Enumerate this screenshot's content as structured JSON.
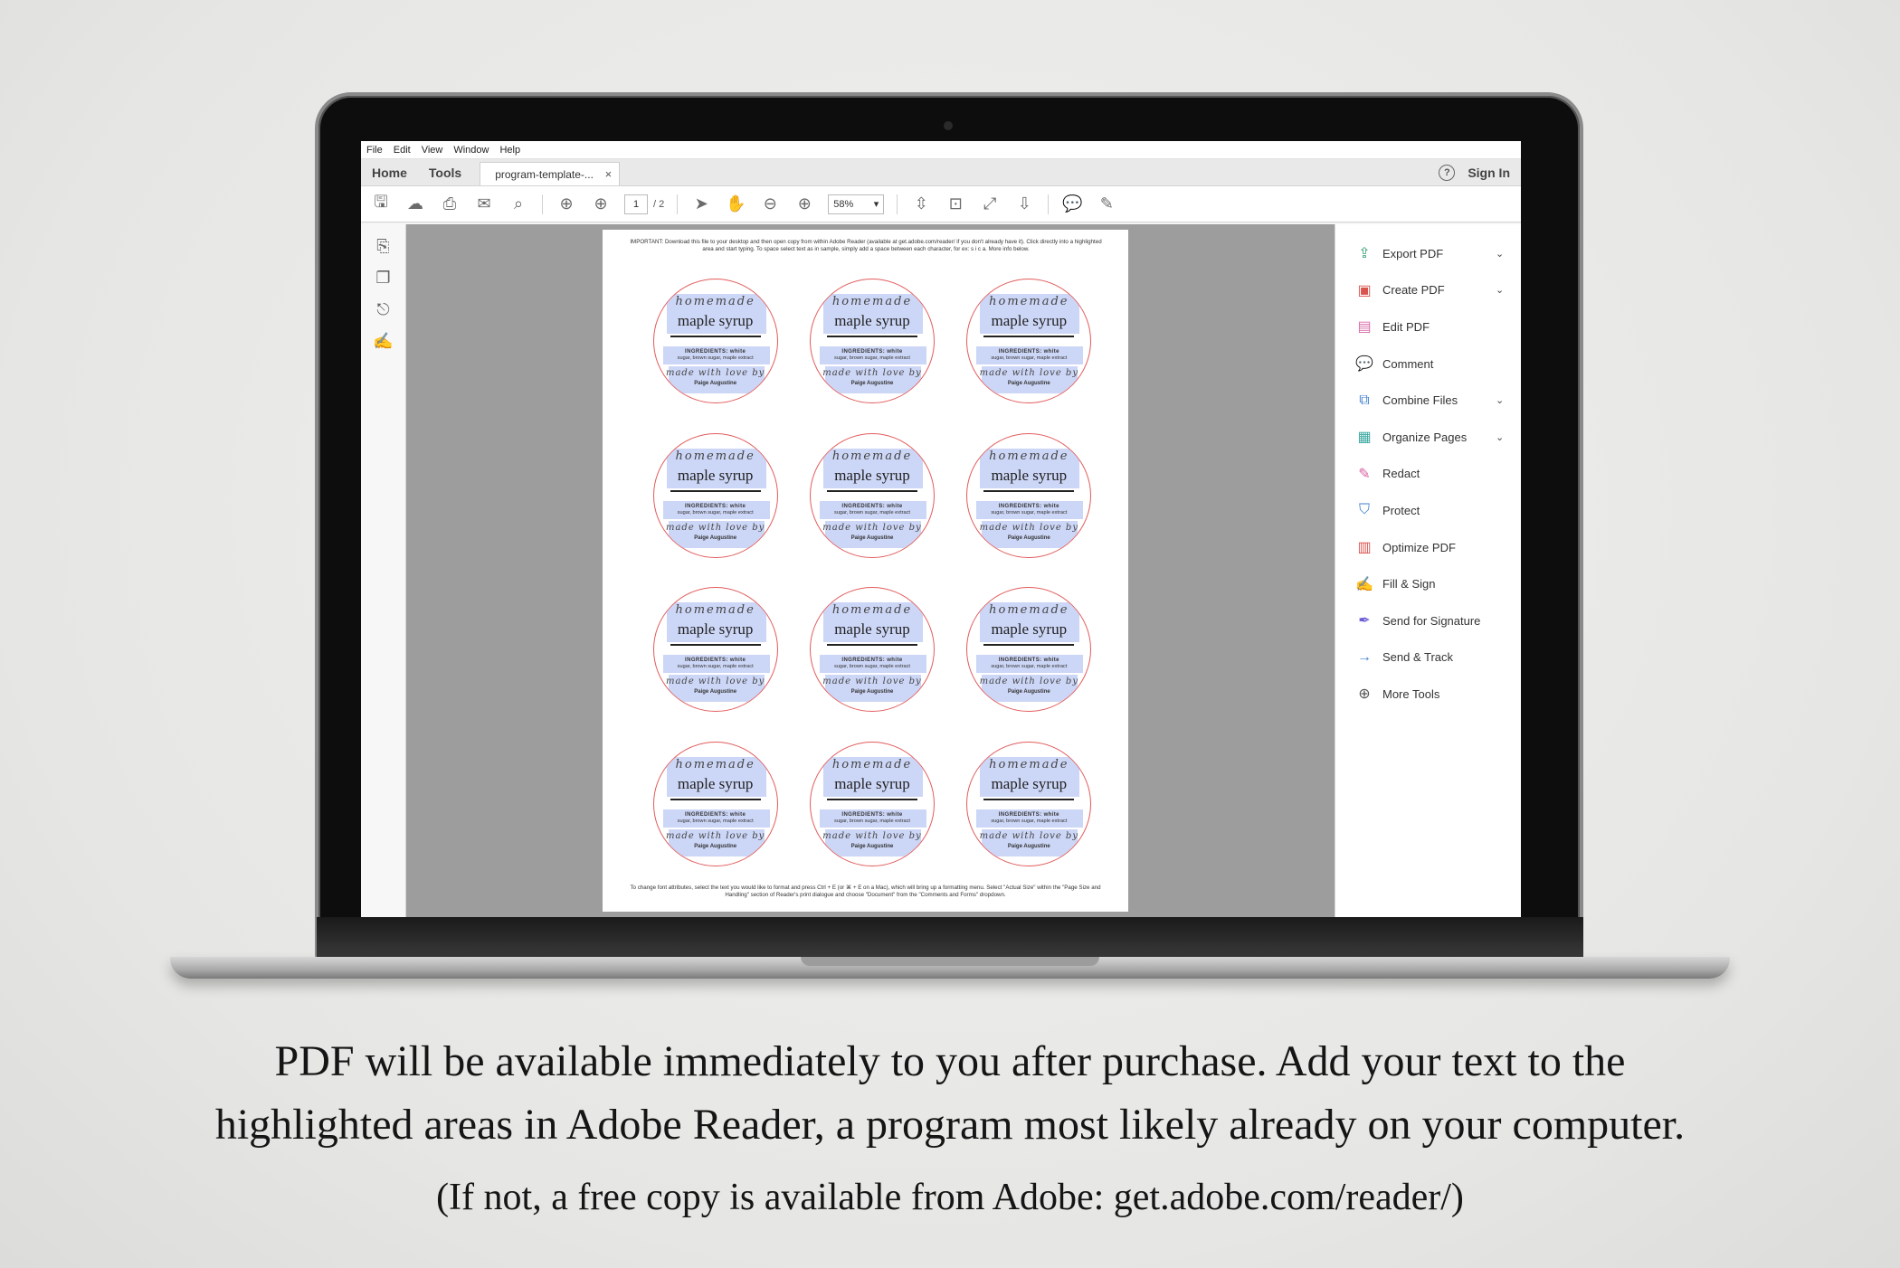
{
  "menu": [
    "File",
    "Edit",
    "View",
    "Window",
    "Help"
  ],
  "tabs": {
    "home": "Home",
    "tools": "Tools",
    "document": "program-template-...",
    "close": "×"
  },
  "header": {
    "help_glyph": "?",
    "sign_in": "Sign In"
  },
  "toolbar": {
    "page_current": "1",
    "page_total": "/ 2",
    "zoom": "58%",
    "zoom_caret": "▾"
  },
  "pdf": {
    "note": "IMPORTANT: Download this file to your desktop and then open copy from within Adobe Reader (available at get.adobe.com/reader/ if you don't already have it). Click directly into a highlighted area and start typing. To space select text as in sample, simply add a space between each character, for ex: s i c a. More info below.",
    "footer": "To change font attributes, select the text you would like to format and press Ctrl + E (or ⌘ + E on a Mac), which will bring up a formatting menu. Select \"Actual Size\" within the \"Page Size and Handling\" section of Reader's print dialogue and choose \"Document\" from the \"Comments and Forms\" dropdown.",
    "label": {
      "script": "homemade",
      "title": "maple syrup",
      "ingredients": "INGREDIENTS: white",
      "ingredients2": "sugar, brown sugar, maple extract",
      "signature": "made with love by",
      "name": "Paige Augustine"
    }
  },
  "tools": [
    {
      "label": "Export PDF",
      "icon": "export-pdf-icon",
      "color": "#2f9e6f",
      "chevron": true
    },
    {
      "label": "Create PDF",
      "icon": "create-pdf-icon",
      "color": "#d9534f",
      "chevron": true
    },
    {
      "label": "Edit PDF",
      "icon": "edit-pdf-icon",
      "color": "#d96aa7",
      "chevron": false
    },
    {
      "label": "Comment",
      "icon": "comment-icon",
      "color": "#f0c23a",
      "chevron": false
    },
    {
      "label": "Combine Files",
      "icon": "combine-files-icon",
      "color": "#3f7fd1",
      "chevron": true
    },
    {
      "label": "Organize Pages",
      "icon": "organize-pages-icon",
      "color": "#3aa8a0",
      "chevron": true
    },
    {
      "label": "Redact",
      "icon": "redact-icon",
      "color": "#d95fa0",
      "chevron": false
    },
    {
      "label": "Protect",
      "icon": "protect-icon",
      "color": "#3f7fd1",
      "chevron": false
    },
    {
      "label": "Optimize PDF",
      "icon": "optimize-pdf-icon",
      "color": "#d9534f",
      "chevron": false
    },
    {
      "label": "Fill & Sign",
      "icon": "fill-sign-icon",
      "color": "#6b5bd6",
      "chevron": false
    },
    {
      "label": "Send for Signature",
      "icon": "send-signature-icon",
      "color": "#6b5bd6",
      "chevron": false
    },
    {
      "label": "Send & Track",
      "icon": "send-track-icon",
      "color": "#3f7fd1",
      "chevron": false
    },
    {
      "label": "More Tools",
      "icon": "more-tools-icon",
      "color": "#555555",
      "chevron": false
    }
  ],
  "caption": {
    "line1": "PDF will be available immediately to you after purchase.  Add your text to the",
    "line2": "highlighted areas in Adobe Reader, a program most likely already on your computer.",
    "line3": "(If not, a free copy is available from Adobe: get.adobe.com/reader/)"
  }
}
